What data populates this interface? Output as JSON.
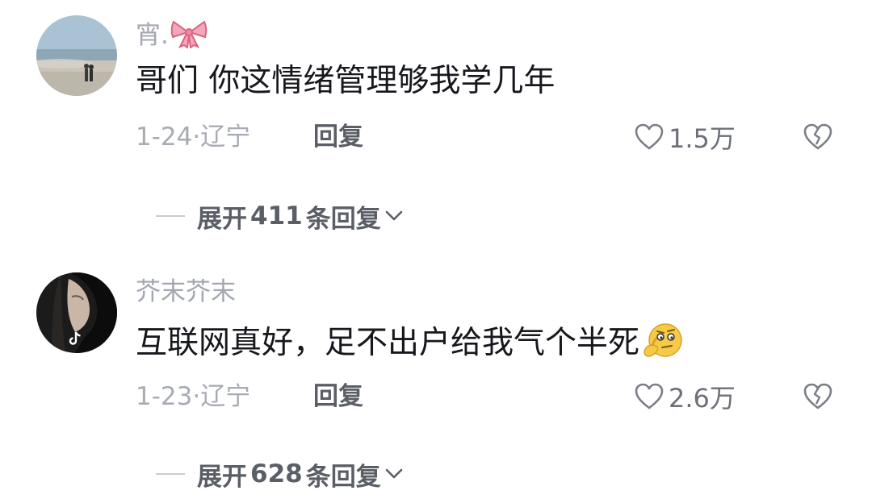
{
  "comments": [
    {
      "username": "宵.",
      "username_icon": "bow-icon",
      "text": "哥们 你这情绪管理够我学几年",
      "date": "1-24",
      "dot": "·",
      "location": "辽宁",
      "reply_label": "回复",
      "likes": "1.5万",
      "expand_prefix": "展开",
      "reply_count": "411",
      "expand_suffix": "条回复"
    },
    {
      "username": "芥末芥末",
      "text": "互联网真好，足不出户给我气个半死",
      "text_emoji": "thinking-face-emoji",
      "avatar_badge_icon": "tiktok-icon",
      "date": "1-23",
      "dot": "·",
      "location": "辽宁",
      "reply_label": "回复",
      "likes": "2.6万",
      "expand_prefix": "展开",
      "reply_count": "628",
      "expand_suffix": "条回复"
    }
  ],
  "colors": {
    "username": "#a3a7b0",
    "content": "#16181d",
    "meta": "#a7abb3",
    "action": "#5a5e66"
  }
}
